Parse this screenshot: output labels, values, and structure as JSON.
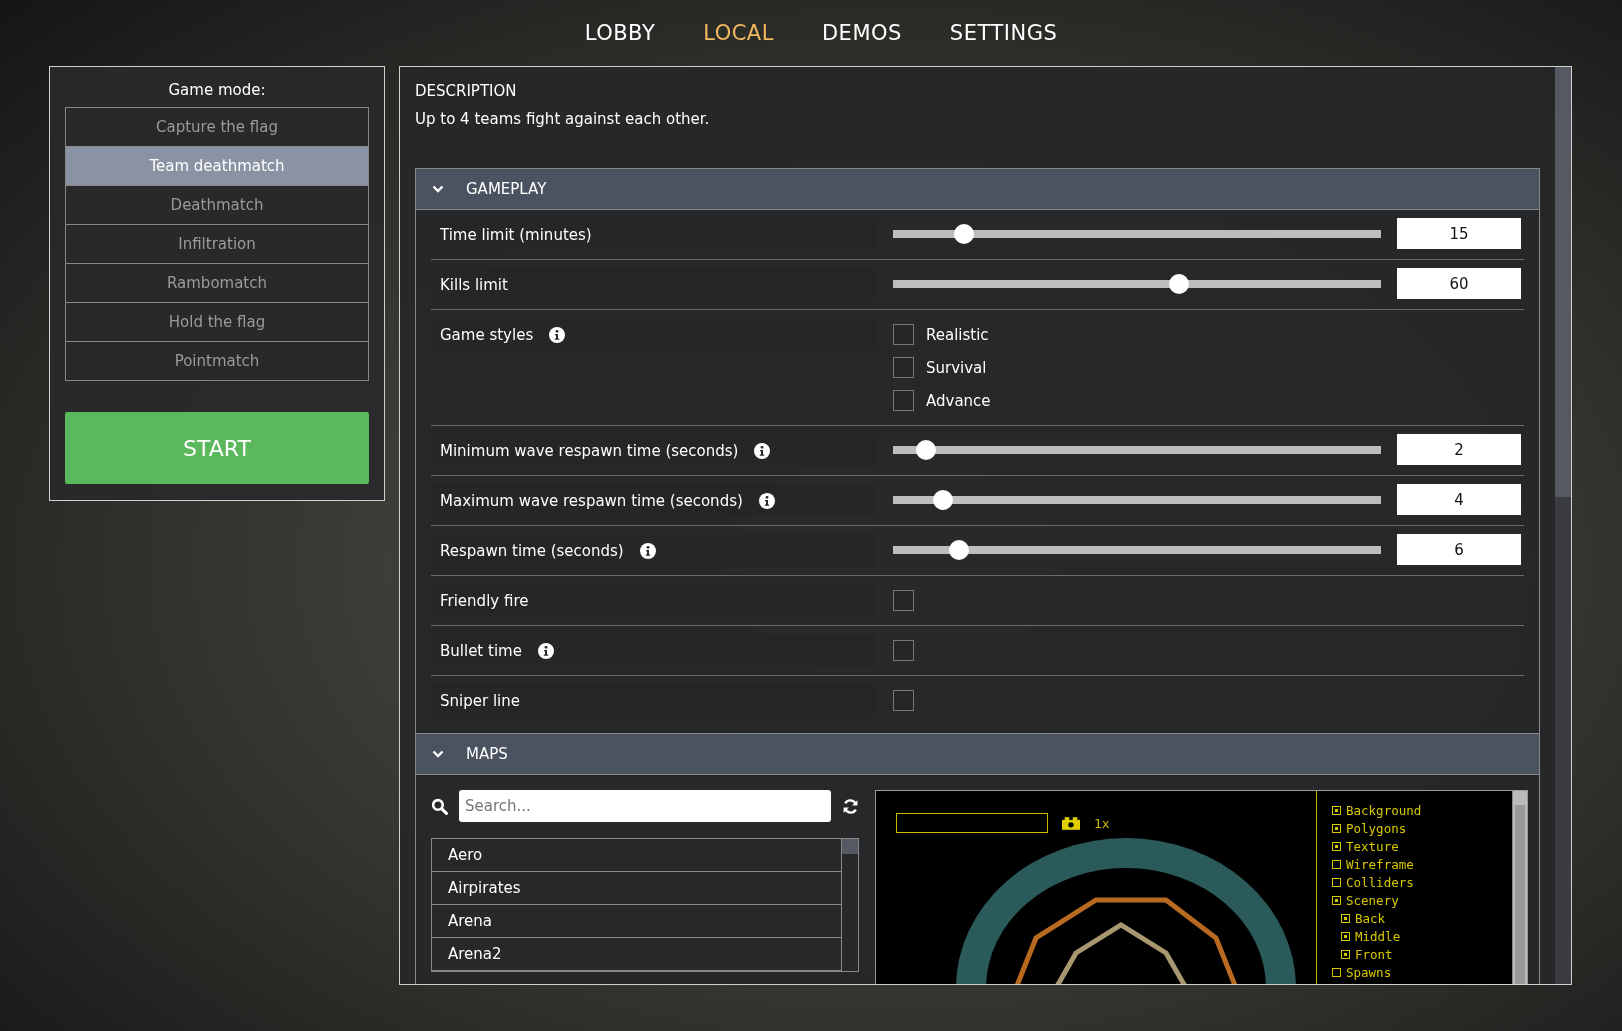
{
  "tabs": [
    {
      "label": "LOBBY",
      "selected": false
    },
    {
      "label": "LOCAL",
      "selected": true
    },
    {
      "label": "DEMOS",
      "selected": false
    },
    {
      "label": "SETTINGS",
      "selected": false
    }
  ],
  "game_mode": {
    "title": "Game mode:",
    "modes": [
      {
        "label": "Capture the flag",
        "selected": false
      },
      {
        "label": "Team deathmatch",
        "selected": true
      },
      {
        "label": "Deathmatch",
        "selected": false
      },
      {
        "label": "Infiltration",
        "selected": false
      },
      {
        "label": "Rambomatch",
        "selected": false
      },
      {
        "label": "Hold the flag",
        "selected": false
      },
      {
        "label": "Pointmatch",
        "selected": false
      }
    ],
    "start_button": "START"
  },
  "description": {
    "heading": "DESCRIPTION",
    "text": "Up to 4 teams fight against each other."
  },
  "gameplay": {
    "title": "GAMEPLAY",
    "expanded": true,
    "settings": [
      {
        "kind": "slider",
        "label": "Time limit (minutes)",
        "info": false,
        "level": 0.13,
        "value": "15"
      },
      {
        "kind": "slider",
        "label": "Kills limit",
        "info": false,
        "level": 0.59,
        "value": "60"
      },
      {
        "kind": "checks",
        "label": "Game styles",
        "info": true,
        "options": [
          {
            "label": "Realistic",
            "checked": false
          },
          {
            "label": "Survival",
            "checked": false
          },
          {
            "label": "Advance",
            "checked": false
          }
        ]
      },
      {
        "kind": "slider",
        "label": "Minimum wave respawn time (seconds)",
        "info": true,
        "level": 0.05,
        "value": "2"
      },
      {
        "kind": "slider",
        "label": "Maximum wave respawn time (seconds)",
        "info": true,
        "level": 0.085,
        "value": "4"
      },
      {
        "kind": "slider",
        "label": "Respawn time (seconds)",
        "info": true,
        "level": 0.12,
        "value": "6"
      },
      {
        "kind": "checkbox",
        "label": "Friendly fire",
        "info": false,
        "checked": false
      },
      {
        "kind": "checkbox",
        "label": "Bullet time",
        "info": true,
        "checked": false
      },
      {
        "kind": "checkbox",
        "label": "Sniper line",
        "info": false,
        "checked": false
      }
    ]
  },
  "maps": {
    "title": "MAPS",
    "expanded": true,
    "search": {
      "placeholder": "Search..."
    },
    "list": [
      {
        "name": "Aero",
        "selected": false
      },
      {
        "name": "Airpirates",
        "selected": false
      },
      {
        "name": "Arena",
        "selected": false
      },
      {
        "name": "Arena2",
        "selected": false
      }
    ],
    "preview": {
      "zoom": "1x",
      "layers": [
        {
          "label": "Background",
          "checked": true
        },
        {
          "label": "Polygons",
          "checked": true
        },
        {
          "label": "Texture",
          "checked": true
        },
        {
          "label": "Wireframe",
          "checked": false
        },
        {
          "label": "Colliders",
          "checked": false
        },
        {
          "label": "Scenery",
          "checked": true,
          "children": [
            {
              "label": "Back",
              "checked": true
            },
            {
              "label": "Middle",
              "checked": true
            },
            {
              "label": "Front",
              "checked": true
            }
          ]
        },
        {
          "label": "Spawns",
          "checked": false
        }
      ]
    }
  }
}
